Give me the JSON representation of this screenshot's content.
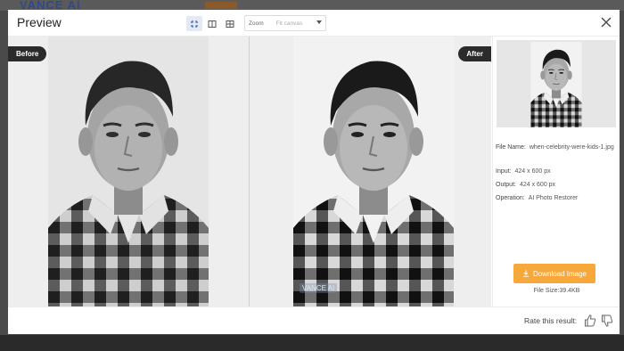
{
  "background": {
    "logo": "VANCE AI"
  },
  "header": {
    "title": "Preview",
    "view_modes": [
      {
        "icon": "fit-screen-icon",
        "active": true
      },
      {
        "icon": "split-view-icon",
        "active": false
      },
      {
        "icon": "grid-view-icon",
        "active": false
      }
    ],
    "zoom": {
      "label": "Zoom",
      "value": "Fit canvas"
    },
    "close_icon": "close-icon"
  },
  "compare": {
    "before_label": "Before",
    "after_label": "After",
    "watermark": "VANCE AI"
  },
  "info": {
    "file_name_label": "File Name:",
    "file_name": "when-celebrity-were-kids-1.jpg",
    "input_label": "Input:",
    "input": "424 x 600 px",
    "output_label": "Output:",
    "output": "424 x 600 px",
    "operation_label": "Operation:",
    "operation": "AI Photo Restorer",
    "download_label": "Download Image",
    "file_size": "File Size:39.4KB"
  },
  "footer": {
    "rate_label": "Rate this result:",
    "thumbs_up_icon": "thumbs-up-icon",
    "thumbs_down_icon": "thumbs-down-icon"
  },
  "colors": {
    "accent": "#f6a83a",
    "tag_bg": "#2b2b2b",
    "active_view_bg": "#e4e9f4"
  }
}
